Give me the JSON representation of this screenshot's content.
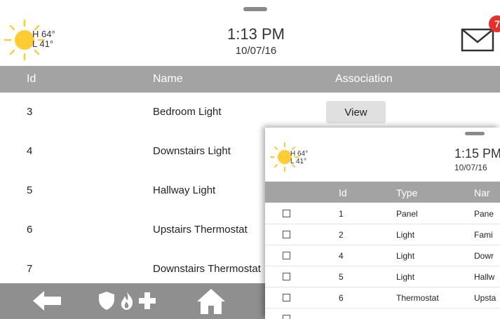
{
  "main": {
    "weather": {
      "high": "H 64°",
      "low": "L 41°"
    },
    "time": "1:13 PM",
    "date": "10/07/16",
    "mail_badge": "7",
    "columns": {
      "id": "Id",
      "name": "Name",
      "association": "Association"
    },
    "rows": [
      {
        "id": "3",
        "name": "Bedroom Light"
      },
      {
        "id": "4",
        "name": "Downstairs Light"
      },
      {
        "id": "5",
        "name": "Hallway Light"
      },
      {
        "id": "6",
        "name": "Upstairs Thermostat"
      },
      {
        "id": "7",
        "name": "Downstairs Thermostat"
      }
    ],
    "view_label": "View",
    "nav_icons": [
      "back-arrow-icon",
      "shield-icon",
      "fire-icon",
      "medical-plus-icon",
      "home-icon"
    ]
  },
  "overlay": {
    "weather": {
      "high": "H 64°",
      "low": "L 41°"
    },
    "time": "1:15 PM",
    "date": "10/07/16",
    "columns": {
      "id": "Id",
      "type": "Type",
      "name": "Nar"
    },
    "rows": [
      {
        "id": "1",
        "type": "Panel",
        "name": "Pane"
      },
      {
        "id": "2",
        "type": "Light",
        "name": "Fami"
      },
      {
        "id": "4",
        "type": "Light",
        "name": "Dowr"
      },
      {
        "id": "5",
        "type": "Light",
        "name": "Hallw"
      },
      {
        "id": "6",
        "type": "Thermostat",
        "name": "Upsta"
      }
    ]
  },
  "colors": {
    "header_bar": "#a3a3a3",
    "nav_bar": "#8f8f8f",
    "sun": "#ffcc33",
    "badge": "#e8302a"
  }
}
